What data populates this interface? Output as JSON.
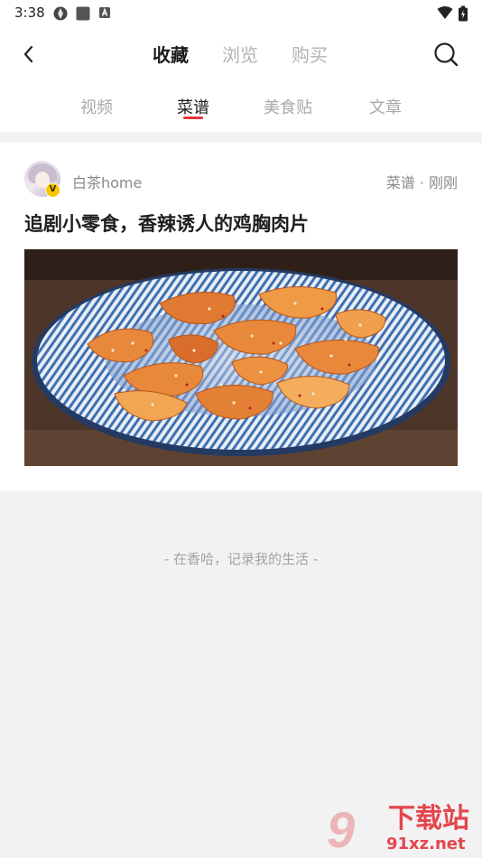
{
  "status_bar": {
    "time": "3:38",
    "left_icons": [
      "app-icon",
      "square-icon",
      "a-icon"
    ],
    "right_icons": [
      "wifi-icon",
      "battery-icon"
    ]
  },
  "header": {
    "back_icon": "back-chevron-icon",
    "tabs": [
      {
        "label": "收藏",
        "active": true
      },
      {
        "label": "浏览",
        "active": false
      },
      {
        "label": "购买",
        "active": false
      }
    ],
    "search_icon": "search-icon"
  },
  "subtabs": [
    {
      "label": "视频",
      "active": false
    },
    {
      "label": "菜谱",
      "active": true
    },
    {
      "label": "美食贴",
      "active": false
    },
    {
      "label": "文章",
      "active": false
    }
  ],
  "post": {
    "author": "白茶home",
    "badge": "V",
    "meta": "菜谱 · 刚刚",
    "title": "追剧小零食，香辣诱人的鸡胸肉片"
  },
  "footer": {
    "slogan": "- 在香哈，记录我的生活 -"
  },
  "watermark": {
    "digits": "9",
    "title": "下载站",
    "url": "91xz.net"
  },
  "colors": {
    "accent": "#e6343b",
    "background": "#f2f2f2",
    "vip": "#f7c600"
  }
}
